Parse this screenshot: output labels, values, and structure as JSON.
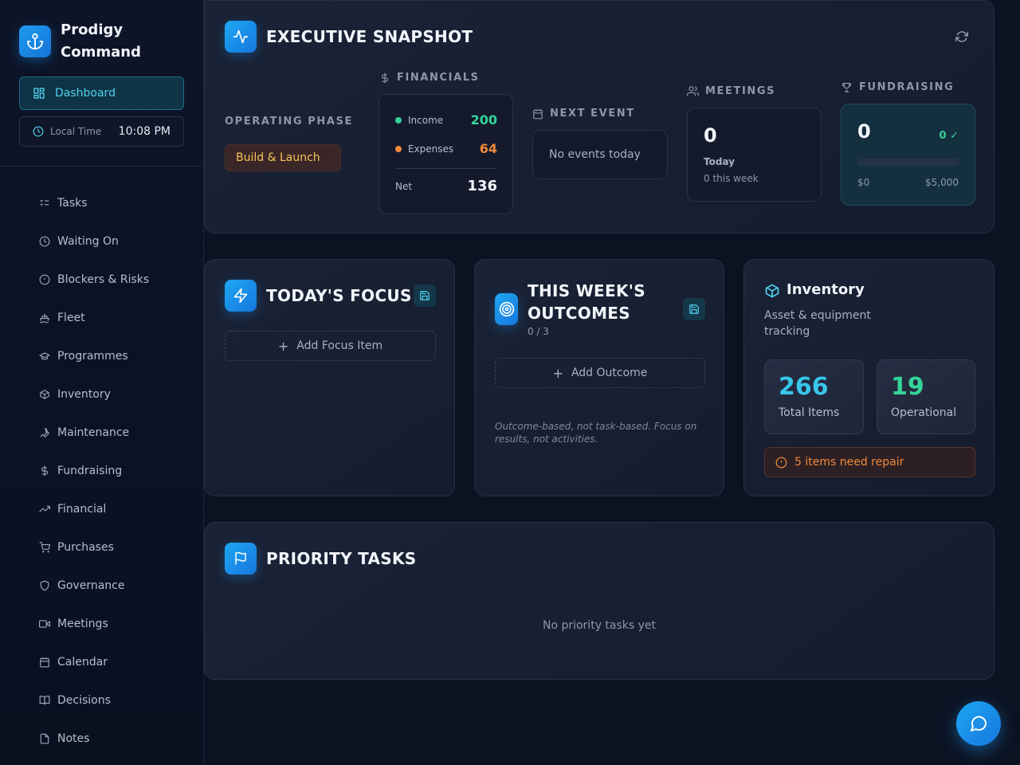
{
  "app": {
    "name": "Prodigy Command"
  },
  "sidebar": {
    "dashboard_label": "Dashboard",
    "local_time_label": "Local Time",
    "local_time_value": "10:08 PM",
    "items": [
      {
        "label": "Tasks",
        "icon": "list-checks-icon"
      },
      {
        "label": "Waiting On",
        "icon": "clock-icon"
      },
      {
        "label": "Blockers & Risks",
        "icon": "alert-circle-icon"
      },
      {
        "label": "Fleet",
        "icon": "ship-icon"
      },
      {
        "label": "Programmes",
        "icon": "graduation-cap-icon"
      },
      {
        "label": "Inventory",
        "icon": "package-icon"
      },
      {
        "label": "Maintenance",
        "icon": "wrench-icon"
      },
      {
        "label": "Fundraising",
        "icon": "dollar-icon"
      },
      {
        "label": "Financial",
        "icon": "trending-up-icon"
      },
      {
        "label": "Purchases",
        "icon": "shopping-cart-icon"
      },
      {
        "label": "Governance",
        "icon": "shield-icon"
      },
      {
        "label": "Meetings",
        "icon": "video-icon"
      },
      {
        "label": "Calendar",
        "icon": "calendar-icon"
      },
      {
        "label": "Decisions",
        "icon": "book-open-icon"
      },
      {
        "label": "Notes",
        "icon": "file-icon"
      }
    ]
  },
  "snapshot": {
    "title": "EXECUTIVE SNAPSHOT",
    "operating_phase": {
      "label": "OPERATING PHASE",
      "value": "Build & Launch"
    },
    "financials": {
      "label": "FINANCIALS",
      "income_label": "Income",
      "income_value": "200",
      "expenses_label": "Expenses",
      "expenses_value": "64",
      "net_label": "Net",
      "net_value": "136"
    },
    "next_event": {
      "label": "NEXT EVENT",
      "value": "No events today"
    },
    "meetings": {
      "label": "MEETINGS",
      "count": "0",
      "today_label": "Today",
      "week_text": "0 this week"
    },
    "fundraising": {
      "label": "FUNDRAISING",
      "amount": "0",
      "badge": "0 ✓",
      "progress_fraction": 0,
      "min_label": "$0",
      "max_label": "$5,000"
    }
  },
  "focus": {
    "title": "TODAY'S FOCUS",
    "add_label": "Add Focus Item"
  },
  "outcomes": {
    "title_line1": "THIS WEEK'S",
    "title_line2": "OUTCOMES",
    "counter": "0 / 3",
    "add_label": "Add Outcome",
    "note": "Outcome-based, not task-based. Focus on results, not activities."
  },
  "inventory": {
    "title": "Inventory",
    "subtitle": "Asset & equipment tracking",
    "total_value": "266",
    "total_label": "Total Items",
    "operational_value": "19",
    "operational_label": "Operational",
    "alert": "5 items need repair"
  },
  "priority": {
    "title": "PRIORITY TASKS",
    "empty": "No priority tasks yet"
  },
  "colors": {
    "accent": "#1ea7f2",
    "cyan": "#4fd1f0",
    "green": "#34d399",
    "orange": "#f08a3c",
    "amber": "#f6c35b"
  }
}
